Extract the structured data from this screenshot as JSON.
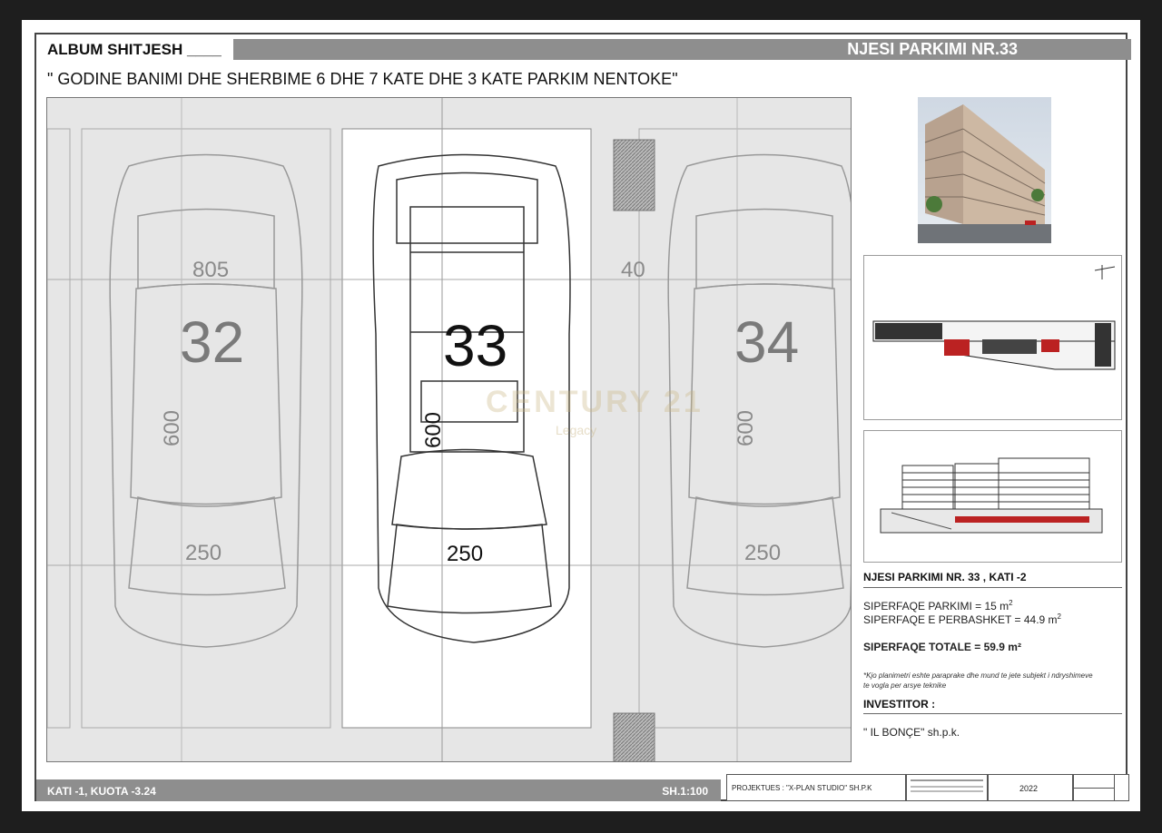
{
  "header": {
    "album": "ALBUM SHITJESH ____",
    "unit_title": "NJESI PARKIMI NR.33",
    "project_subtitle": "\" GODINE BANIMI DHE SHERBIME 6 DHE 7 KATE DHE 3 KATE PARKIM NENTOKE\""
  },
  "plan": {
    "spaces": [
      {
        "number": "32",
        "width_label": "250",
        "length_label": "600",
        "top_label": "805"
      },
      {
        "number": "33",
        "width_label": "250",
        "length_label": "600"
      },
      {
        "number": "34",
        "width_label": "250",
        "length_label": "600"
      }
    ],
    "gap_label": "40",
    "watermark": "CENTURY 21",
    "watermark_sub": "Legacy"
  },
  "info": {
    "heading": "NJESI PARKIMI NR. 33 , KATI -2",
    "parking_area": "SIPERFAQE PARKIMI = 15 m",
    "parking_sup": "2",
    "shared_area": "SIPERFAQE E PERBASHKET = 44.9 m",
    "shared_sup": "2",
    "total": "SIPERFAQE TOTALE = 59.9 m²",
    "note_line1": "*Kjo planimetri eshte paraprake dhe mund te jete subjekt i ndryshimeve",
    "note_line2": "te vogla per arsye teknike",
    "investor_label": "INVESTITOR :",
    "investor_name": "\" IL BONÇE\" sh.p.k."
  },
  "footer": {
    "floor": "KATI -1, KUOTA -3.24",
    "scale": "SH.1:100",
    "designer": "PROJEKTUES :  \"X-PLAN STUDIO\" SH.P.K",
    "year": "2022"
  }
}
